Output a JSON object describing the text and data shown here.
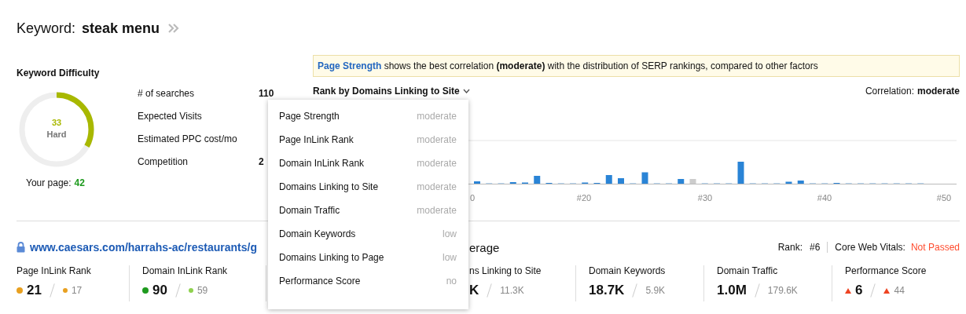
{
  "header": {
    "label": "Keyword:",
    "keyword": "steak menu"
  },
  "difficulty": {
    "title": "Keyword Difficulty",
    "level": 0.33,
    "score": "33",
    "rating": "Hard",
    "your_page_label": "Your page:",
    "your_page_value": "42"
  },
  "metrics": [
    {
      "label": "# of searches",
      "value": "110"
    },
    {
      "label": "Expected Visits"
    },
    {
      "label": "Estimated PPC cost/mo"
    },
    {
      "label": "Competition",
      "value": "2"
    }
  ],
  "notice": {
    "highlight": "Page Strength",
    "text": "shows the best correlation **(moderate)** with the distribution of SERP rankings, compared to other factors"
  },
  "chart": {
    "title": "Rank by Domains Linking to Site",
    "correlation_label": "Correlation:",
    "correlation_value": "moderate",
    "x_labels": [
      "0",
      "#20",
      "#30",
      "#40",
      "#50"
    ]
  },
  "page": {
    "url": "www.caesars.com/harrahs-ac/restaurants/g",
    "heading_fragment": "erage",
    "rank_label": "Rank:",
    "rank_value": "#6",
    "cwv_label": "Core Web Vitals:",
    "cwv_value": "Not Passed"
  },
  "cards": [
    {
      "label": "Page InLink Rank",
      "kind": "dot",
      "color": "#e8a020",
      "value": "21",
      "compare": {
        "text": "17",
        "color": "#e8a020"
      }
    },
    {
      "label": "Domain InLink Rank",
      "kind": "dot",
      "color": "#1e9a1e",
      "value": "90",
      "compare": {
        "text": "59",
        "color": "#8fd14f"
      }
    },
    {
      "label": "ns Linking to Site",
      "kind": "plain",
      "value": "K",
      "compare": {
        "text": "11.3K"
      }
    },
    {
      "label": "Domain Keywords",
      "kind": "plain",
      "value": "18.7K",
      "compare": {
        "text": "5.9K"
      }
    },
    {
      "label": "Domain Traffic",
      "kind": "plain",
      "value": "1.0M",
      "compare": {
        "text": "179.6K"
      }
    },
    {
      "label": "Performance Score",
      "kind": "triangle",
      "color": "#ee4422",
      "value": "6",
      "compare": {
        "text": "44",
        "color": "#ee4422"
      }
    }
  ],
  "menu": {
    "items": [
      {
        "label": "Page Strength",
        "value": "moderate"
      },
      {
        "label": "Page InLink Rank",
        "value": "moderate"
      },
      {
        "label": "Domain InLink Rank",
        "value": "moderate"
      },
      {
        "label": "Domains Linking to Site",
        "value": "moderate"
      },
      {
        "label": "Domain Traffic",
        "value": "moderate"
      },
      {
        "label": "Domain Keywords",
        "value": "low"
      },
      {
        "label": "Domains Linking to Page",
        "value": "low"
      },
      {
        "label": "Performance Score",
        "value": "no"
      }
    ]
  }
}
